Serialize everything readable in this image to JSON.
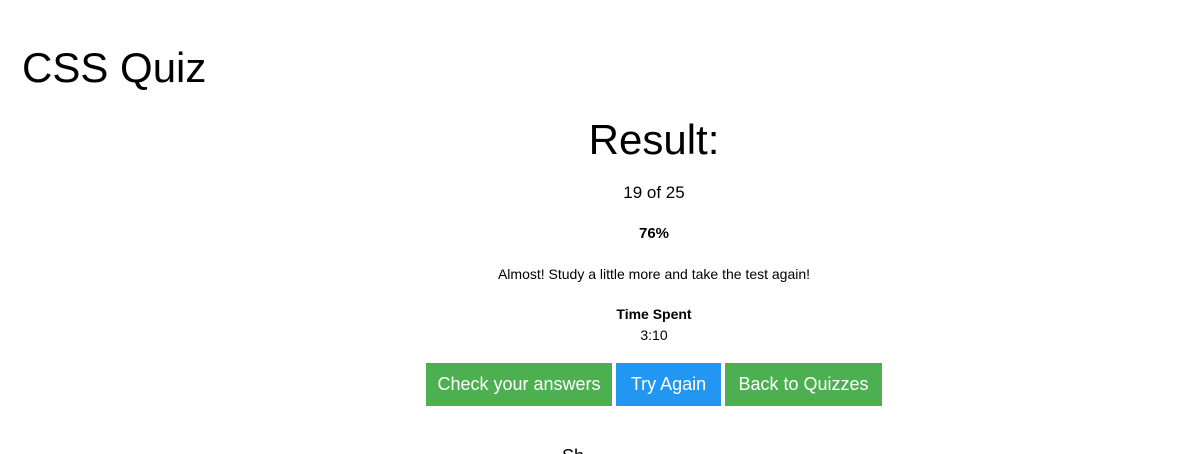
{
  "page": {
    "title": "CSS Quiz"
  },
  "result": {
    "heading": "Result:",
    "score": "19 of 25",
    "percent": "76%",
    "message": "Almost! Study a little more and take the test again!",
    "time_label": "Time Spent",
    "time_value": "3:10"
  },
  "buttons": {
    "check_answers": "Check your answers",
    "try_again": "Try Again",
    "back_to_quizzes": "Back to Quizzes"
  },
  "colors": {
    "green_button": "#4caf50",
    "blue_button": "#2196f3"
  },
  "footer": {
    "cut_text": "Sh"
  }
}
